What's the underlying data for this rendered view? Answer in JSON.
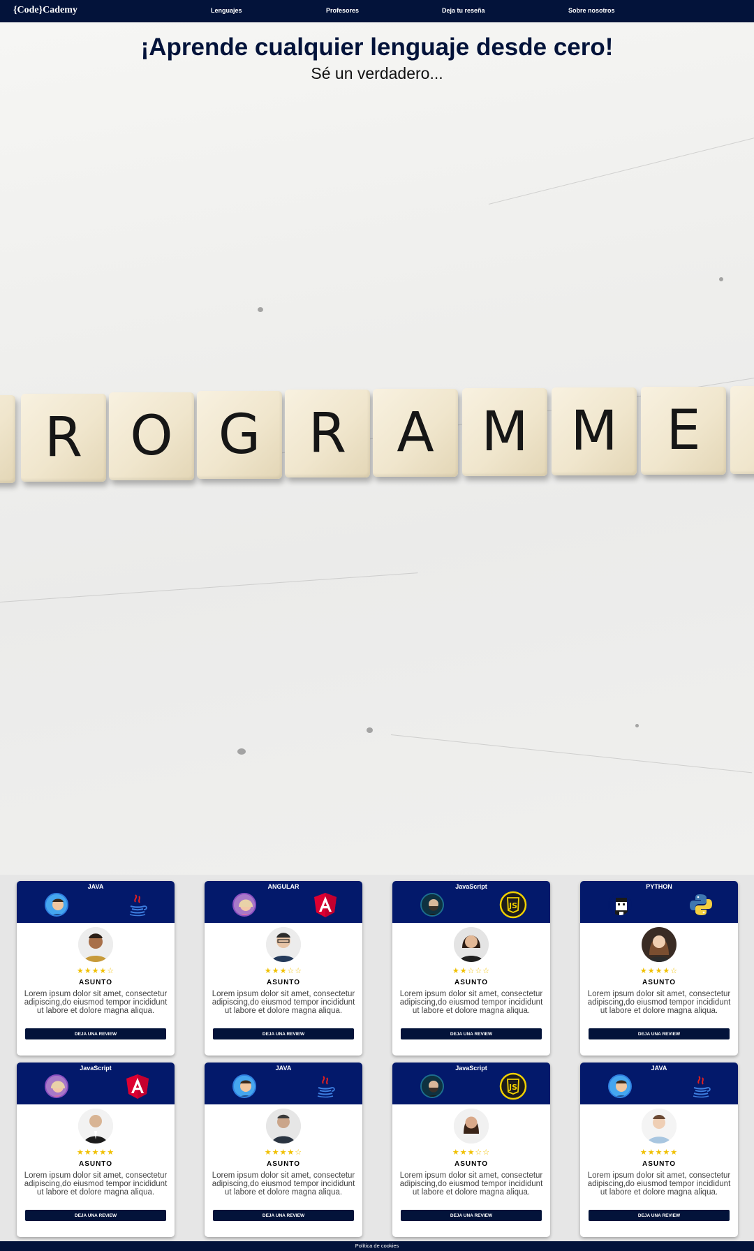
{
  "navbar": {
    "brand": "{Code}Cademy",
    "links": [
      "Lenguajes",
      "Profesores",
      "Deja tu reseña",
      "Sobre nosotros"
    ]
  },
  "hero": {
    "title": "¡Aprende cualquier lenguaje desde cero!",
    "subtitle": "Sé un verdadero...",
    "tiles": [
      "R",
      "O",
      "G",
      "R",
      "A",
      "M",
      "M",
      "E"
    ]
  },
  "cards": [
    {
      "lang": "JAVA",
      "icon": "java-icon",
      "rating": 4,
      "stars": "★★★★☆",
      "subject": "ASUNTO",
      "body": "Lorem ipsum dolor sit amet, consectetur adipiscing,do eiusmod tempor incididunt ut labore et dolore magna aliqua.",
      "button": "DEJA UNA REVIEW"
    },
    {
      "lang": "ANGULAR",
      "icon": "angular-icon",
      "rating": 3,
      "stars": "★★★☆☆",
      "subject": "ASUNTO",
      "body": "Lorem ipsum dolor sit amet, consectetur adipiscing,do eiusmod tempor incididunt ut labore et dolore magna aliqua.",
      "button": "DEJA UNA REVIEW"
    },
    {
      "lang": "JavaScript",
      "icon": "javascript-icon",
      "rating": 2,
      "stars": "★★☆☆☆",
      "subject": "ASUNTO",
      "body": "Lorem ipsum dolor sit amet, consectetur adipiscing,do eiusmod tempor incididunt ut labore et dolore magna aliqua.",
      "button": "DEJA UNA REVIEW"
    },
    {
      "lang": "PYTHON",
      "icon": "python-icon",
      "rating": 4,
      "stars": "★★★★☆",
      "subject": "ASUNTO",
      "body": "Lorem ipsum dolor sit amet, consectetur adipiscing,do eiusmod tempor incididunt ut labore et dolore magna aliqua.",
      "button": "DEJA UNA REVIEW"
    },
    {
      "lang": "JavaScript",
      "icon": "angular-icon",
      "rating": 5,
      "stars": "★★★★★",
      "subject": "ASUNTO",
      "body": "Lorem ipsum dolor sit amet, consectetur adipiscing,do eiusmod tempor incididunt ut labore et dolore magna aliqua.",
      "button": "DEJA UNA REVIEW"
    },
    {
      "lang": "JAVA",
      "icon": "java-icon",
      "rating": 4,
      "stars": "★★★★☆",
      "subject": "ASUNTO",
      "body": "Lorem ipsum dolor sit amet, consectetur adipiscing,do eiusmod tempor incididunt ut labore et dolore magna aliqua.",
      "button": "DEJA UNA REVIEW"
    },
    {
      "lang": "JavaScript",
      "icon": "javascript-icon",
      "rating": 3,
      "stars": "★★★☆☆",
      "subject": "ASUNTO",
      "body": "Lorem ipsum dolor sit amet, consectetur adipiscing,do eiusmod tempor incididunt ut labore et dolore magna aliqua.",
      "button": "DEJA UNA REVIEW"
    },
    {
      "lang": "JAVA",
      "icon": "java-icon",
      "rating": 5,
      "stars": "★★★★★",
      "subject": "ASUNTO",
      "body": "Lorem ipsum dolor sit amet, consectetur adipiscing,do eiusmod tempor incididunt ut labore et dolore magna aliqua.",
      "button": "DEJA UNA REVIEW"
    }
  ],
  "footer": {
    "cookies": "Política de cookies"
  },
  "colors": {
    "navy": "#03133a",
    "card_header": "#03196b",
    "star": "#f0c000"
  }
}
